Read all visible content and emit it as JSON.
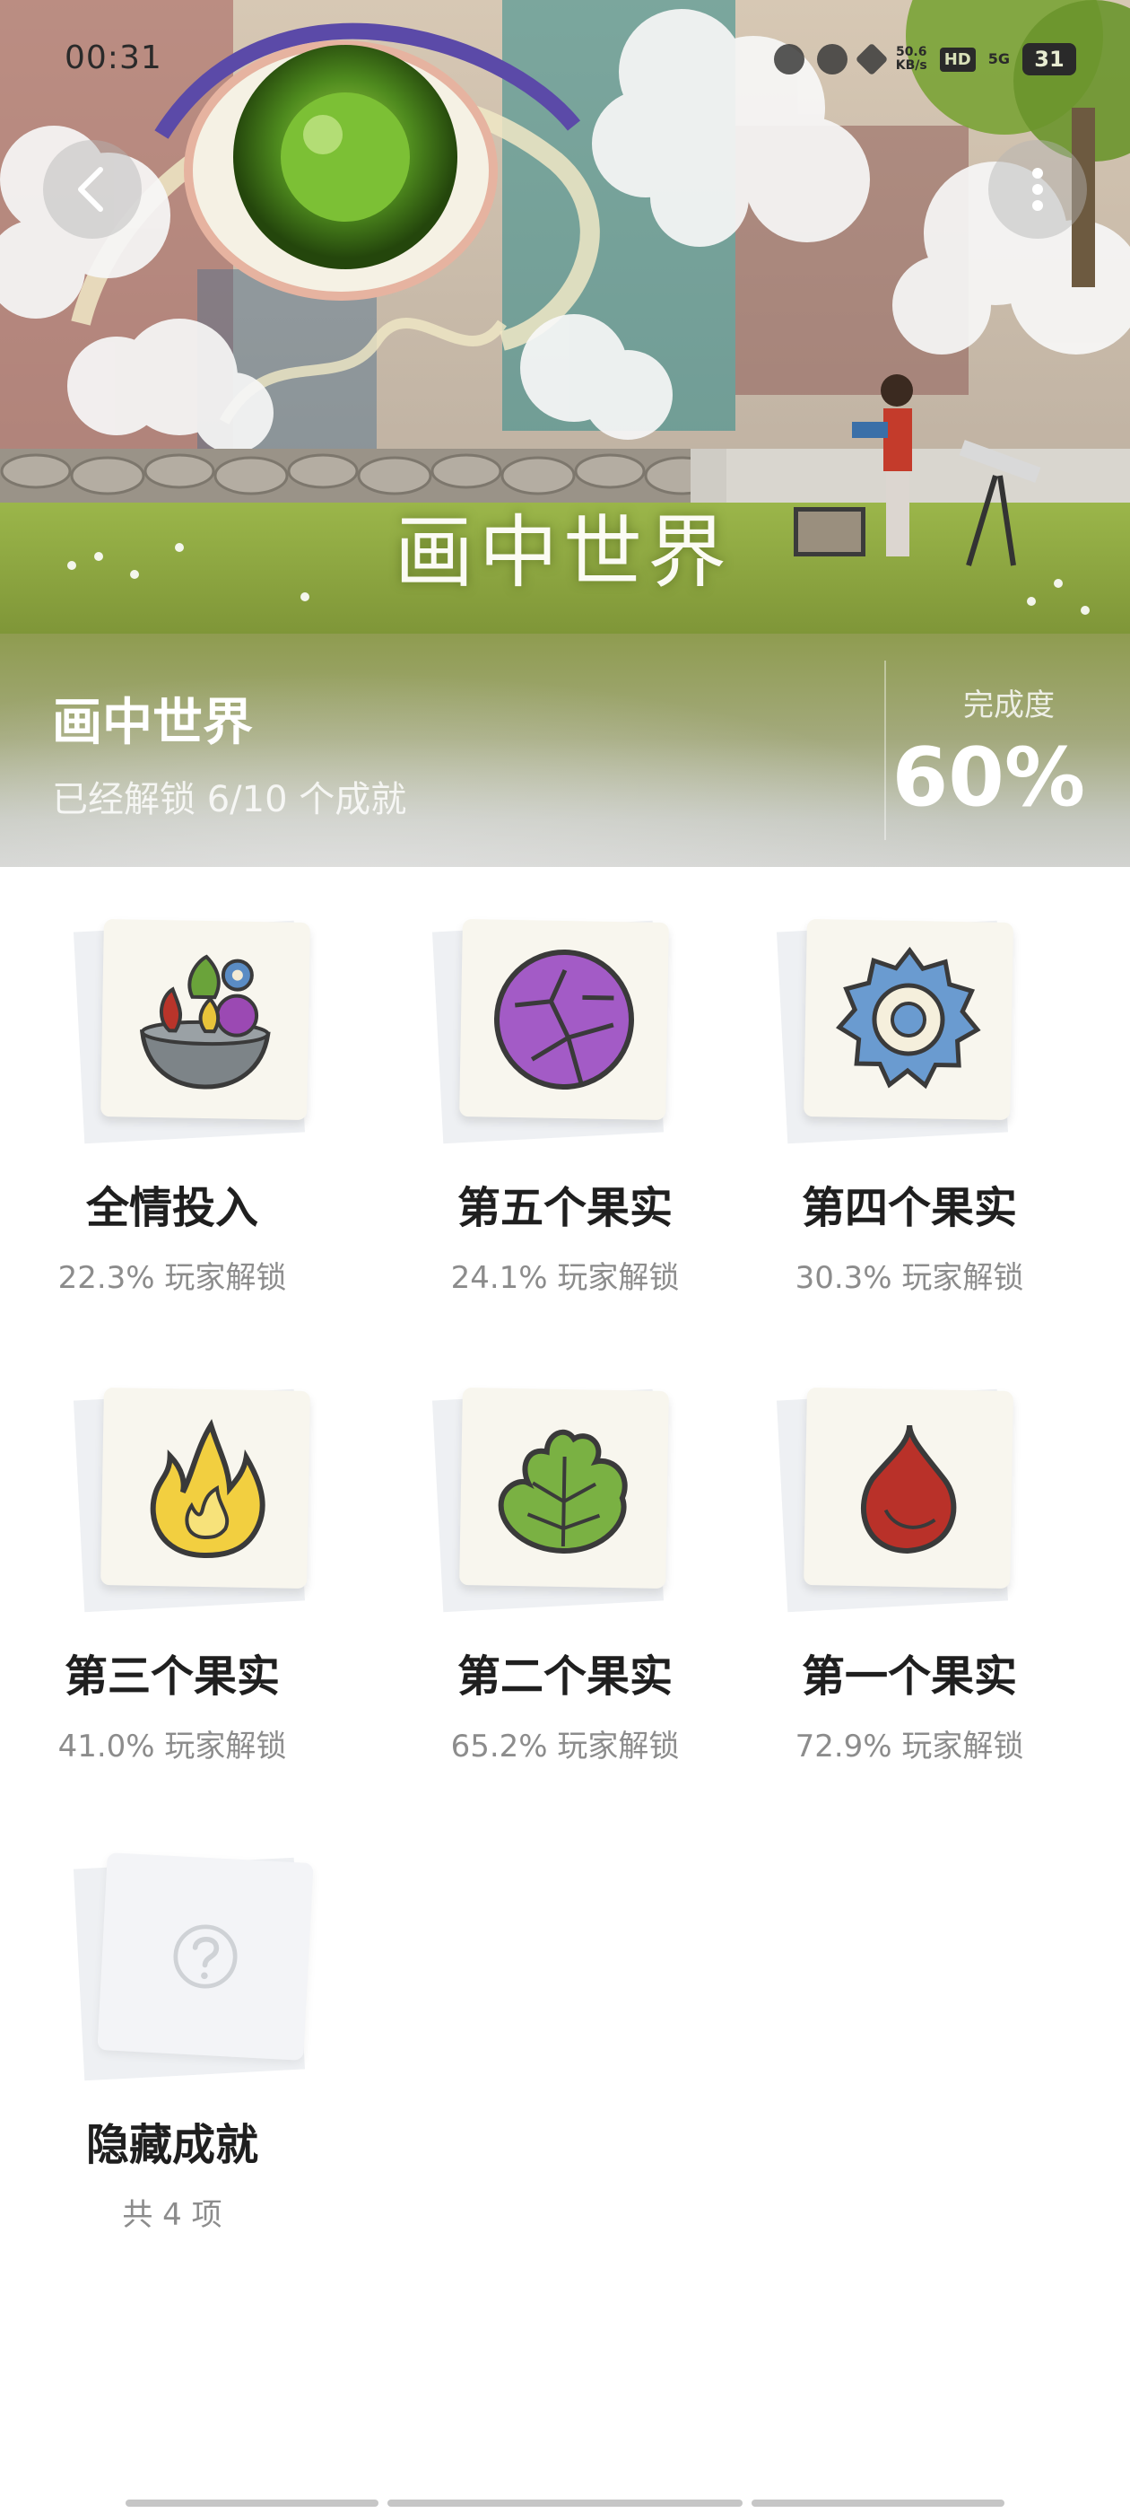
{
  "status_bar": {
    "time": "00:31",
    "net_speed_top": "50.6",
    "net_speed_unit": "KB/s",
    "hd_label": "HD",
    "network_label": "5G",
    "battery_level": "31"
  },
  "header": {
    "art_title": "画中世界",
    "game_title": "画中世界",
    "subtitle": "已经解锁 6/10 个成就",
    "completion_label": "完成度",
    "completion_value": "60%"
  },
  "achievements": [
    {
      "name": "全情投入",
      "percent_text": "22.3% 玩家解锁",
      "icon": "fruit-bowl-icon"
    },
    {
      "name": "第五个果实",
      "percent_text": "24.1% 玩家解锁",
      "icon": "purple-fruit-icon"
    },
    {
      "name": "第四个果实",
      "percent_text": "30.3% 玩家解锁",
      "icon": "blue-gear-fruit-icon"
    },
    {
      "name": "第三个果实",
      "percent_text": "41.0% 玩家解锁",
      "icon": "yellow-flame-fruit-icon"
    },
    {
      "name": "第二个果实",
      "percent_text": "65.2% 玩家解锁",
      "icon": "green-leaf-fruit-icon"
    },
    {
      "name": "第一个果实",
      "percent_text": "72.9% 玩家解锁",
      "icon": "red-drop-fruit-icon"
    }
  ],
  "hidden": {
    "name": "隐藏成就",
    "count_text": "共 4 项",
    "icon": "question-mark-icon"
  },
  "colors": {
    "banner_bottom": "#8f9c50",
    "title_text": "#1f1f1f",
    "muted_text": "#8c8c8c"
  }
}
